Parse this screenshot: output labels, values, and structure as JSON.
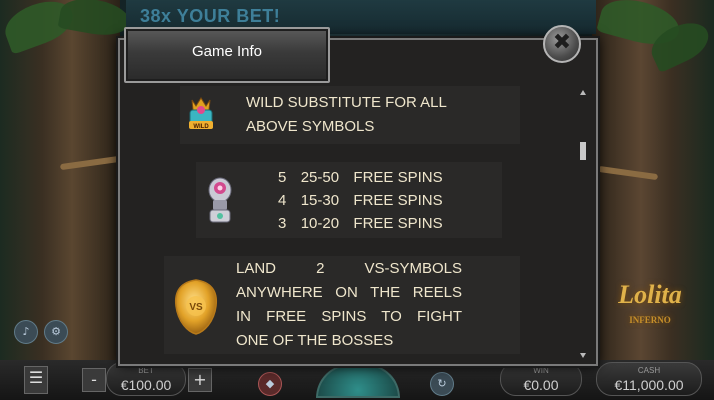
{
  "banner": {
    "text": "38x YOUR BET!"
  },
  "modal": {
    "title": "Game Info",
    "close_icon": "close-x-icon",
    "wild_row": {
      "line1": "WILD SUBSTITUTE FOR ALL",
      "line2": "ABOVE SYMBOLS",
      "symbol": "wild-symbol"
    },
    "free_spins_row": {
      "symbol": "vs-skull-symbol",
      "rows": [
        {
          "count": "5",
          "range": "25-50",
          "label": "FREE SPINS"
        },
        {
          "count": "4",
          "range": "15-30",
          "label": "FREE SPINS"
        },
        {
          "count": "3",
          "range": "10-20",
          "label": "FREE SPINS"
        }
      ]
    },
    "bonus_row": {
      "symbol": "vs-badge-symbol",
      "line1": [
        "LAND",
        "2",
        "VS-SYMBOLS"
      ],
      "line2": "ANYWHERE ON THE REELS",
      "line3": "IN FREE SPINS TO FIGHT",
      "line4": "ONE OF THE BOSSES"
    }
  },
  "bottom_bar": {
    "bet": {
      "label": "BET",
      "value": "€100.00"
    },
    "win": {
      "label": "WIN",
      "value": "€0.00"
    },
    "cash": {
      "label": "CASH",
      "value": "€11,000.00"
    },
    "minus": "-",
    "plus": "+"
  },
  "logo": {
    "title": "Lolita",
    "subtitle": "INFERNO"
  },
  "colors": {
    "text": "#efe6cc",
    "modal_bg": "#232221",
    "border": "#7a7a7a"
  }
}
